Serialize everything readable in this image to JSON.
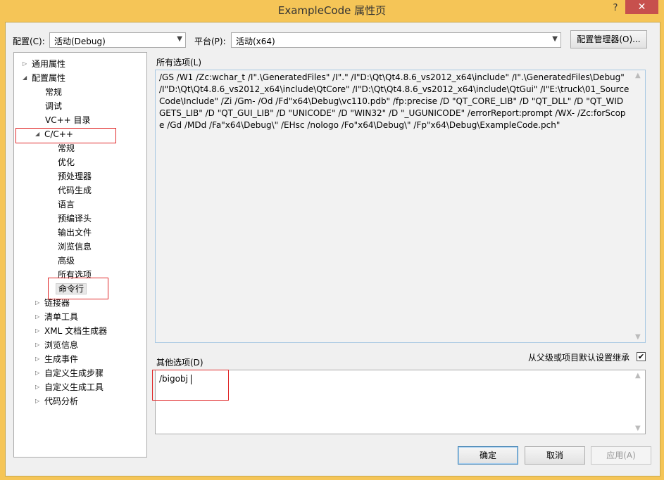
{
  "window": {
    "title": "ExampleCode 属性页",
    "help_label": "?",
    "close_label": "✕"
  },
  "config_bar": {
    "config_label": "配置(C):",
    "config_value": "活动(Debug)",
    "platform_label": "平台(P):",
    "platform_value": "活动(x64)",
    "config_manager_label": "配置管理器(O)..."
  },
  "tree": {
    "items": [
      {
        "label": "通用属性",
        "expander": "▷"
      },
      {
        "label": "配置属性",
        "expander": "◢"
      },
      {
        "label": "常规"
      },
      {
        "label": "调试"
      },
      {
        "label": "VC++ 目录"
      },
      {
        "label": "C/C++",
        "expander": "◢"
      },
      {
        "label": "常规"
      },
      {
        "label": "优化"
      },
      {
        "label": "预处理器"
      },
      {
        "label": "代码生成"
      },
      {
        "label": "语言"
      },
      {
        "label": "预编译头"
      },
      {
        "label": "输出文件"
      },
      {
        "label": "浏览信息"
      },
      {
        "label": "高级"
      },
      {
        "label": "所有选项"
      },
      {
        "label": "命令行"
      },
      {
        "label": "链接器",
        "expander": "▷"
      },
      {
        "label": "清单工具",
        "expander": "▷"
      },
      {
        "label": "XML 文档生成器",
        "expander": "▷"
      },
      {
        "label": "浏览信息",
        "expander": "▷"
      },
      {
        "label": "生成事件",
        "expander": "▷"
      },
      {
        "label": "自定义生成步骤",
        "expander": "▷"
      },
      {
        "label": "自定义生成工具",
        "expander": "▷"
      },
      {
        "label": "代码分析",
        "expander": "▷"
      }
    ]
  },
  "all_options": {
    "label": "所有选项(L)",
    "text": "/GS /W1 /Zc:wchar_t /I\".\\GeneratedFiles\" /I\".\" /I\"D:\\Qt\\Qt4.8.6_vs2012_x64\\include\" /I\".\\GeneratedFiles\\Debug\" /I\"D:\\Qt\\Qt4.8.6_vs2012_x64\\include\\QtCore\" /I\"D:\\Qt\\Qt4.8.6_vs2012_x64\\include\\QtGui\" /I\"E:\\truck\\01_SourceCode\\Include\" /Zi /Gm- /Od /Fd\"x64\\Debug\\vc110.pdb\" /fp:precise /D \"QT_CORE_LIB\" /D \"QT_DLL\" /D \"QT_WIDGETS_LIB\" /D \"QT_GUI_LIB\" /D \"UNICODE\" /D \"WIN32\" /D \"_UGUNICODE\" /errorReport:prompt /WX- /Zc:forScope /Gd /MDd /Fa\"x64\\Debug\\\" /EHsc /nologo /Fo\"x64\\Debug\\\" /Fp\"x64\\Debug\\ExampleCode.pch\""
  },
  "other_options": {
    "label": "其他选项(D)",
    "value": "/bigobj",
    "inherit_label": "从父级或项目默认设置继承",
    "inherit_checked": true
  },
  "buttons": {
    "ok": "确定",
    "cancel": "取消",
    "apply": "应用(A)"
  }
}
